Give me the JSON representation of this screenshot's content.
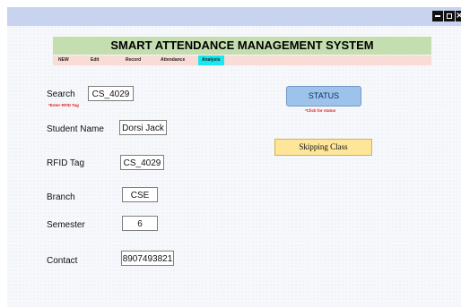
{
  "window": {
    "controls": [
      "minimize",
      "maximize",
      "close"
    ]
  },
  "header": {
    "title": "SMART ATTENDANCE MANAGEMENT SYSTEM"
  },
  "menu": {
    "items": [
      "NEW",
      "Edit",
      "Record",
      "Attendance",
      "Analysis"
    ],
    "active": "Analysis"
  },
  "form": {
    "search_label": "Search",
    "search_value": "CS_4029",
    "search_hint": "*Enter RFID Tag",
    "student_name_label": "Student Name",
    "student_name_value": "Dorsi Jack",
    "rfid_label": "RFID Tag",
    "rfid_value": "CS_4029",
    "branch_label": "Branch",
    "branch_value": "CSE",
    "semester_label": "Semester",
    "semester_value": "6",
    "contact_label": "Contact",
    "contact_value": "8907493821"
  },
  "status": {
    "button_label": "STATUS",
    "hint": "*Click for status",
    "result": "Skipping Class"
  },
  "colors": {
    "titlebar": "#c7d3ef",
    "header_bg": "#c5deb0",
    "menubar_bg": "#f8dcd5",
    "active_menu": "#19e6f0",
    "status_button": "#9dc3ea",
    "result_box": "#fde59a",
    "hint_red": "#e02020"
  }
}
